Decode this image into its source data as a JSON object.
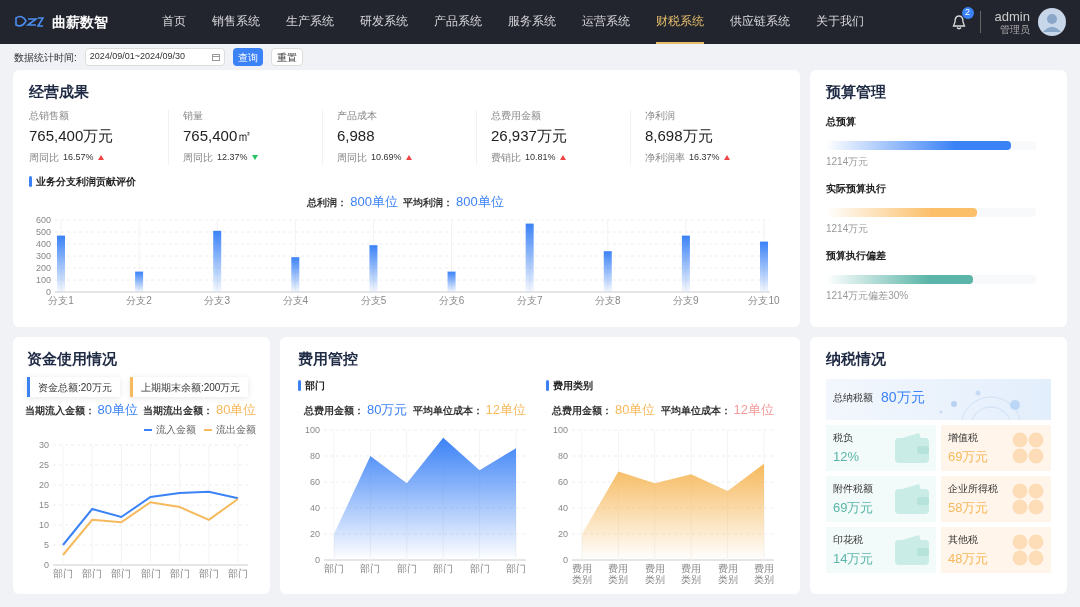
{
  "header": {
    "logo_text": "曲薪数智",
    "nav": [
      {
        "label": "首页",
        "selected": false
      },
      {
        "label": "销售系统",
        "selected": false
      },
      {
        "label": "生产系统",
        "selected": false
      },
      {
        "label": "研发系统",
        "selected": false
      },
      {
        "label": "产品系统",
        "selected": false
      },
      {
        "label": "服务系统",
        "selected": false
      },
      {
        "label": "运营系统",
        "selected": false
      },
      {
        "label": "财税系统",
        "selected": true
      },
      {
        "label": "供应链系统",
        "selected": false
      },
      {
        "label": "关于我们",
        "selected": false
      }
    ],
    "notification_count": "2",
    "user": {
      "name": "admin",
      "role": "管理员"
    }
  },
  "filter": {
    "label": "数据统计时间:",
    "date_range": "2024/09/01~2024/09/30",
    "buttons": [
      {
        "label": "查询",
        "kind": "primary"
      },
      {
        "label": "重置",
        "kind": "default"
      }
    ]
  },
  "operations": {
    "title": "经营成果",
    "metrics": [
      {
        "label": "总销售额",
        "value": "765,400万元",
        "change_label": "周同比",
        "change": "16.57%",
        "rising": true
      },
      {
        "label": "销量",
        "value": "765,400㎡",
        "change_label": "周同比",
        "change": "12.37%",
        "rising": false
      },
      {
        "label": "产品成本",
        "value": "6,988",
        "change_label": "周同比",
        "change": "10.69%",
        "rising": true
      },
      {
        "label": "总费用金额",
        "value": "26,937万元",
        "change_label": "费销比",
        "change": "10.81%",
        "rising": true
      },
      {
        "label": "净利润",
        "value": "8,698万元",
        "change_label": "净利润率",
        "change": "16.37%",
        "rising": true
      }
    ],
    "section_title": "业务分支利润贡献评价",
    "summary": [
      {
        "label": "总利润：",
        "value": "800单位",
        "color": "#3b82f6"
      },
      {
        "label": "平均利润：",
        "value": "800单位",
        "color": "#3b82f6"
      }
    ],
    "chart_data": {
      "type": "bar",
      "categories": [
        "分支1",
        "分支2",
        "分支3",
        "分支4",
        "分支5",
        "分支6",
        "分支7",
        "分支8",
        "分支9",
        "分支10"
      ],
      "series": [
        {
          "color": "#3b82f6",
          "values": [
            470,
            170,
            510,
            290,
            390,
            170,
            570,
            340,
            470,
            420
          ]
        }
      ],
      "ylim": [
        0,
        600
      ],
      "grid": true,
      "yticks": [
        0,
        100,
        200,
        300,
        400,
        500,
        600
      ]
    }
  },
  "budget": {
    "title": "预算管理",
    "items": [
      {
        "label": "总预算",
        "level": 0.88,
        "note": "1214万元",
        "color": "#3b82f6"
      },
      {
        "label": "实际预算执行",
        "level": 0.72,
        "note": "1214万元",
        "color": "#fbbf6a"
      },
      {
        "label": "预算执行偏差",
        "level": 0.7,
        "note": "1214万元偏差30%",
        "color": "#5bb5a8"
      }
    ]
  },
  "funds": {
    "title": "资金使用情况",
    "stats": [
      {
        "label": "资金总额:20万元",
        "color": "#3b82f6"
      },
      {
        "label": "上期期末余额:200万元",
        "color": "#f6b95c"
      }
    ],
    "summary": [
      {
        "label": "当期流入金额：",
        "value": "80单位",
        "color": "#3b82f6"
      },
      {
        "label": "当期流出金额：",
        "value": "80单位",
        "color": "#f6b95c"
      }
    ],
    "chart_data": {
      "type": "line",
      "categories": [
        "部门",
        "部门",
        "部门",
        "部门",
        "部门",
        "部门",
        "部门"
      ],
      "series": [
        {
          "name": "流入金额",
          "color": "#3b82f6",
          "values": [
            5,
            14,
            12,
            17,
            18,
            18.3,
            16.7
          ]
        },
        {
          "name": "流出金额",
          "color": "#f6b95c",
          "values": [
            2.5,
            11.3,
            10.7,
            15.7,
            14.5,
            11.3,
            16.5
          ]
        }
      ],
      "ylim": [
        0,
        30
      ],
      "grid": true,
      "yticks": [
        0,
        5,
        10,
        15,
        20,
        25,
        30
      ]
    }
  },
  "expense": {
    "title": "费用管控",
    "panels": [
      {
        "title": "部门",
        "summary": [
          {
            "label": "总费用金额：",
            "value": "80万元",
            "color": "#3b82f6"
          },
          {
            "label": "平均单位成本：",
            "value": "12单位",
            "color": "#f6b95c"
          }
        ],
        "chart_data": {
          "type": "area",
          "categories": [
            "部门",
            "部门",
            "部门",
            "部门",
            "部门",
            "部门"
          ],
          "series": [
            {
              "color": "#3b82f6",
              "values": [
                20,
                80,
                59,
                94,
                69,
                86
              ]
            }
          ],
          "ylim": [
            0,
            100
          ],
          "grid": true,
          "yticks": [
            0,
            20,
            40,
            60,
            80,
            100
          ]
        }
      },
      {
        "title": "费用类别",
        "summary": [
          {
            "label": "总费用金额：",
            "value": "80单位",
            "color": "#f6b95c"
          },
          {
            "label": "平均单位成本：",
            "value": "12单位",
            "color": "#f49a9a"
          }
        ],
        "chart_data": {
          "type": "area",
          "categories": [
            "费用类别",
            "费用类别",
            "费用类别",
            "费用类别",
            "费用类别",
            "费用类别"
          ],
          "series": [
            {
              "color": "#f6b95c",
              "values": [
                20,
                68,
                59,
                66,
                53,
                74
              ]
            }
          ],
          "ylim": [
            0,
            100
          ],
          "grid": true,
          "yticks": [
            0,
            20,
            40,
            60,
            80,
            100
          ]
        }
      }
    ]
  },
  "tax": {
    "title": "纳税情况",
    "total": {
      "label": "总纳税额",
      "value": "80万元"
    },
    "items": [
      {
        "label": "税负",
        "value": "12%",
        "kind": "wallet"
      },
      {
        "label": "增值税",
        "value": "69万元",
        "kind": "clover"
      },
      {
        "label": "附件税额",
        "value": "69万元",
        "kind": "wallet"
      },
      {
        "label": "企业所得税",
        "value": "58万元",
        "kind": "clover"
      },
      {
        "label": "印花税",
        "value": "14万元",
        "kind": "wallet"
      },
      {
        "label": "其他税",
        "value": "48万元",
        "kind": "clover"
      }
    ]
  }
}
